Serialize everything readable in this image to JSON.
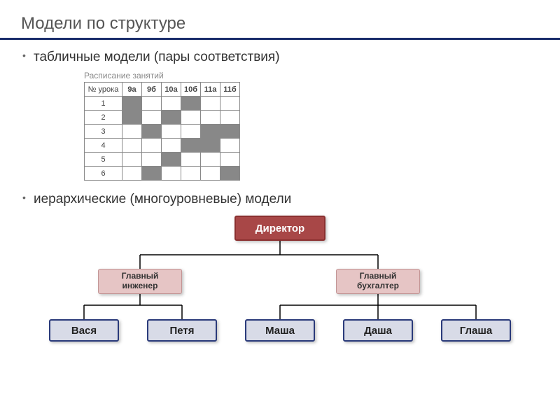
{
  "title": "Модели по структуре",
  "bullets": {
    "tabular": "табличные модели (пары соответствия)",
    "hierarchical": "иерархические (многоуровневые) модели"
  },
  "schedule": {
    "caption": "Расписание занятий",
    "row_header": "№ урока",
    "columns": [
      "9а",
      "9б",
      "10а",
      "10б",
      "11а",
      "11б"
    ],
    "rows": [
      "1",
      "2",
      "3",
      "4",
      "5",
      "6"
    ],
    "filled": [
      [
        1,
        0,
        0,
        1,
        0,
        0
      ],
      [
        1,
        0,
        1,
        0,
        0,
        0
      ],
      [
        0,
        1,
        0,
        0,
        1,
        1
      ],
      [
        0,
        0,
        0,
        1,
        1,
        0
      ],
      [
        0,
        0,
        1,
        0,
        0,
        0
      ],
      [
        0,
        1,
        0,
        0,
        0,
        1
      ]
    ]
  },
  "hierarchy": {
    "root": "Директор",
    "chief_engineer": "Главный\nинженер",
    "chief_accountant": "Главный\nбухгалтер",
    "leaves": {
      "vasya": "Вася",
      "petya": "Петя",
      "masha": "Маша",
      "dasha": "Даша",
      "glasha": "Глаша"
    }
  }
}
